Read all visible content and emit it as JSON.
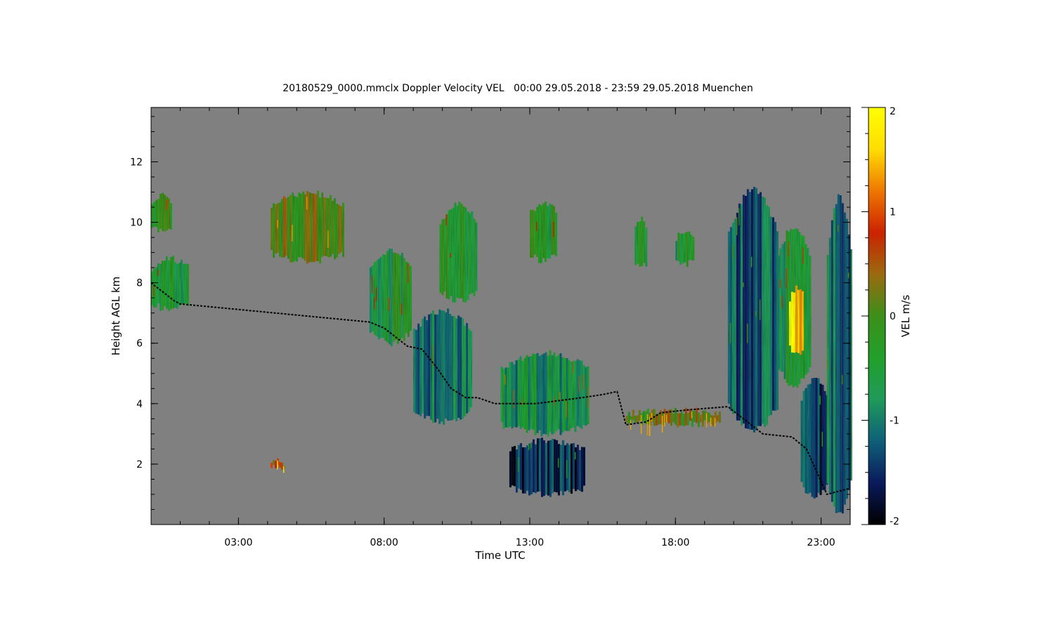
{
  "chart_data": {
    "type": "heatmap",
    "title": "20180529_0000.mmclx Doppler Velocity VEL   00:00 29.05.2018 - 23:59 29.05.2018 Muenchen",
    "xlabel": "Time UTC",
    "ylabel": "Height AGL km",
    "colorbar_label": "VEL m/s",
    "xlim": [
      0,
      24
    ],
    "ylim": [
      0,
      13.8
    ],
    "zlim": [
      -2,
      2
    ],
    "x_ticks": [
      {
        "value": 3,
        "label": "03:00"
      },
      {
        "value": 8,
        "label": "08:00"
      },
      {
        "value": 13,
        "label": "13:00"
      },
      {
        "value": 18,
        "label": "18:00"
      },
      {
        "value": 23,
        "label": "23:00"
      }
    ],
    "y_ticks": [
      {
        "value": 2,
        "label": "2"
      },
      {
        "value": 4,
        "label": "4"
      },
      {
        "value": 6,
        "label": "6"
      },
      {
        "value": 8,
        "label": "8"
      },
      {
        "value": 10,
        "label": "10"
      },
      {
        "value": 12,
        "label": "12"
      }
    ],
    "colorbar_ticks": [
      {
        "value": 2,
        "label": "2"
      },
      {
        "value": 1,
        "label": "1"
      },
      {
        "value": 0,
        "label": "0"
      },
      {
        "value": -1,
        "label": "-1"
      },
      {
        "value": -2,
        "label": "-2"
      }
    ],
    "colormap": [
      "#000000",
      "#0a1a5c",
      "#0f5f78",
      "#1f9a5a",
      "#21a02b",
      "#3c8f1a",
      "#9a6a10",
      "#cc2200",
      "#ee7700",
      "#ffdd00",
      "#ffff00"
    ],
    "background_color": "#808080",
    "cloud_regions": [
      {
        "t0": 0.0,
        "t1": 0.7,
        "h0": 9.6,
        "h1": 11.0,
        "vel": -0.3
      },
      {
        "t0": 0.0,
        "t1": 1.3,
        "h0": 7.0,
        "h1": 8.9,
        "vel": -0.5
      },
      {
        "t0": 4.1,
        "t1": 6.6,
        "h0": 8.6,
        "h1": 11.1,
        "vel": 0.1
      },
      {
        "t0": 7.5,
        "t1": 8.9,
        "h0": 5.9,
        "h1": 9.2,
        "vel": -0.5
      },
      {
        "t0": 9.0,
        "t1": 11.0,
        "h0": 3.3,
        "h1": 7.2,
        "vel": -1.0
      },
      {
        "t0": 9.9,
        "t1": 11.2,
        "h0": 7.3,
        "h1": 10.7,
        "vel": -0.4
      },
      {
        "t0": 12.0,
        "t1": 15.0,
        "h0": 2.9,
        "h1": 5.8,
        "vel": -0.8
      },
      {
        "t0": 12.3,
        "t1": 14.9,
        "h0": 0.9,
        "h1": 2.9,
        "vel": -1.5
      },
      {
        "t0": 13.0,
        "t1": 13.9,
        "h0": 8.6,
        "h1": 10.8,
        "vel": -0.4
      },
      {
        "t0": 16.6,
        "t1": 17.0,
        "h0": 8.4,
        "h1": 10.2,
        "vel": -0.4
      },
      {
        "t0": 18.0,
        "t1": 18.6,
        "h0": 8.5,
        "h1": 9.8,
        "vel": -0.5
      },
      {
        "t0": 16.3,
        "t1": 19.5,
        "h0": 3.2,
        "h1": 3.9,
        "vel": 0.2
      },
      {
        "t0": 19.8,
        "t1": 21.5,
        "h0": 3.0,
        "h1": 11.2,
        "vel": -1.2
      },
      {
        "t0": 21.5,
        "t1": 22.6,
        "h0": 4.5,
        "h1": 10.0,
        "vel": -0.6
      },
      {
        "t0": 21.9,
        "t1": 22.4,
        "h0": 5.5,
        "h1": 8.0,
        "vel": 1.7
      },
      {
        "t0": 22.3,
        "t1": 23.2,
        "h0": 0.8,
        "h1": 5.0,
        "vel": -1.4
      },
      {
        "t0": 23.2,
        "t1": 24.0,
        "h0": 0.2,
        "h1": 11.0,
        "vel": -1.1
      },
      {
        "t0": 4.1,
        "t1": 4.6,
        "h0": 1.8,
        "h1": 2.2,
        "vel": 0.6
      }
    ],
    "cloud_base_line": [
      [
        0.0,
        8.0
      ],
      [
        0.8,
        7.4
      ],
      [
        1.0,
        7.3
      ],
      [
        7.5,
        6.7
      ],
      [
        8.0,
        6.5
      ],
      [
        8.8,
        5.9
      ],
      [
        9.3,
        5.8
      ],
      [
        9.8,
        5.2
      ],
      [
        10.3,
        4.5
      ],
      [
        10.8,
        4.2
      ],
      [
        11.2,
        4.2
      ],
      [
        11.8,
        4.0
      ],
      [
        12.5,
        4.0
      ],
      [
        13.2,
        4.0
      ],
      [
        14.0,
        4.1
      ],
      [
        14.8,
        4.2
      ],
      [
        15.5,
        4.3
      ],
      [
        16.0,
        4.4
      ],
      [
        16.3,
        3.3
      ],
      [
        17.0,
        3.4
      ],
      [
        17.5,
        3.7
      ],
      [
        18.5,
        3.8
      ],
      [
        19.8,
        3.9
      ],
      [
        21.0,
        3.0
      ],
      [
        22.0,
        2.9
      ],
      [
        22.5,
        2.5
      ],
      [
        23.2,
        1.0
      ],
      [
        24.0,
        1.2
      ]
    ]
  }
}
